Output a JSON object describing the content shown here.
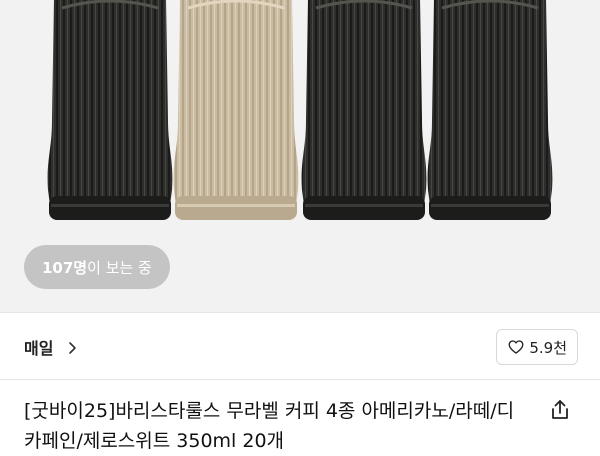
{
  "hero": {
    "bottles": [
      {
        "color": "#2f2f2d",
        "name": "dark"
      },
      {
        "color": "#c9baa0",
        "name": "beige"
      },
      {
        "color": "#2f2f2d",
        "name": "dark"
      },
      {
        "color": "#2f2f2d",
        "name": "dark"
      }
    ],
    "viewers": {
      "count": "107명",
      "suffix": "이 보는 중"
    }
  },
  "seller": {
    "name": "매일",
    "chevron_icon": "chevron-right-icon",
    "likes": "5.9천",
    "like_icon": "heart-outline-icon"
  },
  "product": {
    "title": "[굿바이25]바리스타룰스 무라벨 커피 4종 아메리카노/라떼/디카페인/제로스위트 350ml 20개",
    "share_icon": "share-icon"
  }
}
